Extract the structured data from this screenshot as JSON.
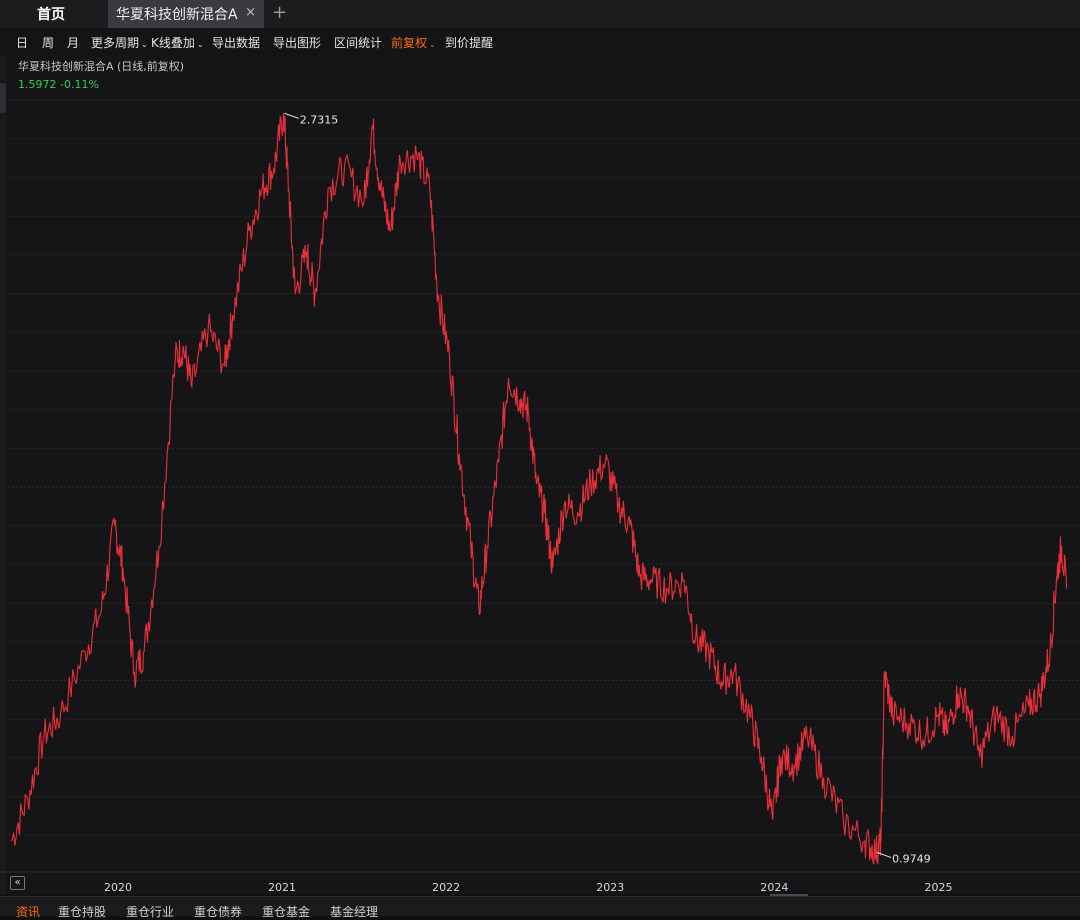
{
  "tabs": {
    "home": "首页",
    "active": "华夏科技创新混合A",
    "close": "×",
    "add": "+"
  },
  "toolbar": {
    "items": [
      {
        "label": "日",
        "active": true
      },
      {
        "label": "周"
      },
      {
        "label": "月"
      },
      {
        "label": "更多周期",
        "dropdown": true
      },
      {
        "label": "K线叠加",
        "dropdown": true
      },
      {
        "label": "导出数据"
      },
      {
        "label": "导出图形"
      },
      {
        "label": "区间统计"
      },
      {
        "label": "前复权",
        "dropdown": true,
        "active": true
      },
      {
        "label": "到价提醒"
      }
    ]
  },
  "chart_header": {
    "title": "华夏科技创新混合A (日线,前复权)",
    "price": "1.5972",
    "change": "-0.11%"
  },
  "colors": {
    "line": "#e8303a",
    "up_text": "#2bd157",
    "accent": "#ff6a00"
  },
  "chart_data": {
    "type": "line",
    "x_ticks": [
      "2020",
      "2021",
      "2022",
      "2023",
      "2024",
      "2025"
    ],
    "ylim": [
      0.95,
      2.78
    ],
    "grid": true,
    "series": [
      {
        "values": [
          [
            2019.35,
            1.0
          ],
          [
            2019.45,
            1.1
          ],
          [
            2019.55,
            1.25
          ],
          [
            2019.65,
            1.3
          ],
          [
            2019.8,
            1.45
          ],
          [
            2019.9,
            1.55
          ],
          [
            2019.98,
            1.75
          ],
          [
            2020.03,
            1.65
          ],
          [
            2020.1,
            1.4
          ],
          [
            2020.16,
            1.45
          ],
          [
            2020.25,
            1.7
          ],
          [
            2020.35,
            2.15
          ],
          [
            2020.4,
            2.17
          ],
          [
            2020.45,
            2.08
          ],
          [
            2020.55,
            2.22
          ],
          [
            2020.65,
            2.13
          ],
          [
            2020.7,
            2.25
          ],
          [
            2020.8,
            2.45
          ],
          [
            2020.88,
            2.55
          ],
          [
            2020.95,
            2.6
          ],
          [
            2021.01,
            2.73
          ],
          [
            2021.04,
            2.55
          ],
          [
            2021.08,
            2.3
          ],
          [
            2021.15,
            2.4
          ],
          [
            2021.2,
            2.3
          ],
          [
            2021.28,
            2.55
          ],
          [
            2021.38,
            2.6
          ],
          [
            2021.5,
            2.52
          ],
          [
            2021.55,
            2.7
          ],
          [
            2021.6,
            2.55
          ],
          [
            2021.66,
            2.45
          ],
          [
            2021.72,
            2.62
          ],
          [
            2021.82,
            2.63
          ],
          [
            2021.9,
            2.55
          ],
          [
            2021.95,
            2.3
          ],
          [
            2022.02,
            2.15
          ],
          [
            2022.08,
            1.92
          ],
          [
            2022.15,
            1.7
          ],
          [
            2022.2,
            1.55
          ],
          [
            2022.25,
            1.7
          ],
          [
            2022.32,
            1.9
          ],
          [
            2022.38,
            2.1
          ],
          [
            2022.45,
            2.05
          ],
          [
            2022.5,
            2.02
          ],
          [
            2022.55,
            1.85
          ],
          [
            2022.6,
            1.78
          ],
          [
            2022.65,
            1.65
          ],
          [
            2022.72,
            1.8
          ],
          [
            2022.8,
            1.78
          ],
          [
            2022.88,
            1.85
          ],
          [
            2022.97,
            1.9
          ],
          [
            2023.05,
            1.8
          ],
          [
            2023.12,
            1.75
          ],
          [
            2023.18,
            1.63
          ],
          [
            2023.25,
            1.62
          ],
          [
            2023.35,
            1.6
          ],
          [
            2023.45,
            1.62
          ],
          [
            2023.52,
            1.48
          ],
          [
            2023.6,
            1.45
          ],
          [
            2023.68,
            1.38
          ],
          [
            2023.75,
            1.4
          ],
          [
            2023.85,
            1.3
          ],
          [
            2023.92,
            1.2
          ],
          [
            2023.99,
            1.05
          ],
          [
            2024.04,
            1.2
          ],
          [
            2024.12,
            1.18
          ],
          [
            2024.2,
            1.25
          ],
          [
            2024.3,
            1.15
          ],
          [
            2024.42,
            1.05
          ],
          [
            2024.55,
            1.0
          ],
          [
            2024.62,
            0.975
          ],
          [
            2024.65,
            1.0
          ],
          [
            2024.67,
            1.4
          ],
          [
            2024.72,
            1.3
          ],
          [
            2024.82,
            1.28
          ],
          [
            2024.92,
            1.25
          ],
          [
            2025.0,
            1.3
          ],
          [
            2025.05,
            1.26
          ],
          [
            2025.12,
            1.35
          ],
          [
            2025.18,
            1.32
          ],
          [
            2025.25,
            1.2
          ],
          [
            2025.35,
            1.3
          ],
          [
            2025.45,
            1.25
          ],
          [
            2025.55,
            1.32
          ],
          [
            2025.62,
            1.35
          ],
          [
            2025.68,
            1.45
          ],
          [
            2025.72,
            1.63
          ],
          [
            2025.75,
            1.7
          ],
          [
            2025.78,
            1.6
          ]
        ]
      }
    ],
    "annotations": [
      {
        "label": "2.7315",
        "x": 2021.01,
        "y": 2.7315
      },
      {
        "label": "0.9749",
        "x": 2024.62,
        "y": 0.9749
      }
    ]
  },
  "bottom_tabs": [
    {
      "label": "资讯",
      "active": true
    },
    {
      "label": "重仓持股"
    },
    {
      "label": "重仓行业"
    },
    {
      "label": "重仓债券"
    },
    {
      "label": "重仓基金"
    },
    {
      "label": "基金经理"
    }
  ],
  "collapse_icon": "«"
}
